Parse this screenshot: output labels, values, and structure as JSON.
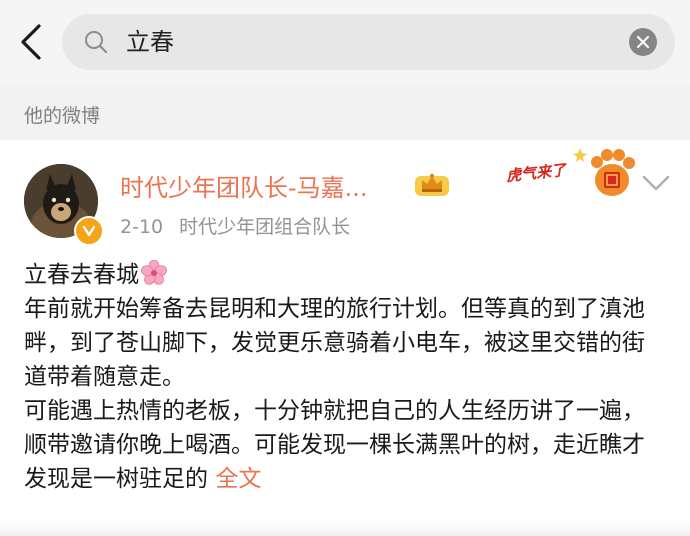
{
  "search": {
    "query": "立春"
  },
  "section": {
    "title": "他的微博"
  },
  "post": {
    "user_name": "时代少年团队长-马嘉...",
    "sticker_text": "虎气来了",
    "date": "2-10",
    "source": "时代少年团组合队长",
    "title_line": "立春去春城",
    "paragraph1": "年前就开始筹备去昆明和大理的旅行计划。但等真的到了滇池畔，到了苍山脚下，发觉更乐意骑着小电车，被这里交错的街道带着随意走。",
    "paragraph2": "可能遇上热情的老板，十分钟就把自己的人生经历讲了一遍，顺带邀请你晚上喝酒。可能发现一棵长满黑叶的树，走近瞧才发现是一树驻足的",
    "expand_label": "全文"
  },
  "colors": {
    "name_accent": "#eb7350",
    "verified_badge": "#f6a318",
    "background_gray": "#f5f5f5"
  },
  "icons": {
    "back": "chevron-left-icon",
    "search": "search-icon",
    "clear": "close-icon",
    "verified": "verified-badge-icon",
    "member": "member-crown-icon",
    "sticker": "tiger-paw-sticker-icon",
    "dropdown": "chevron-down-icon",
    "blossom": "cherry-blossom-icon"
  }
}
